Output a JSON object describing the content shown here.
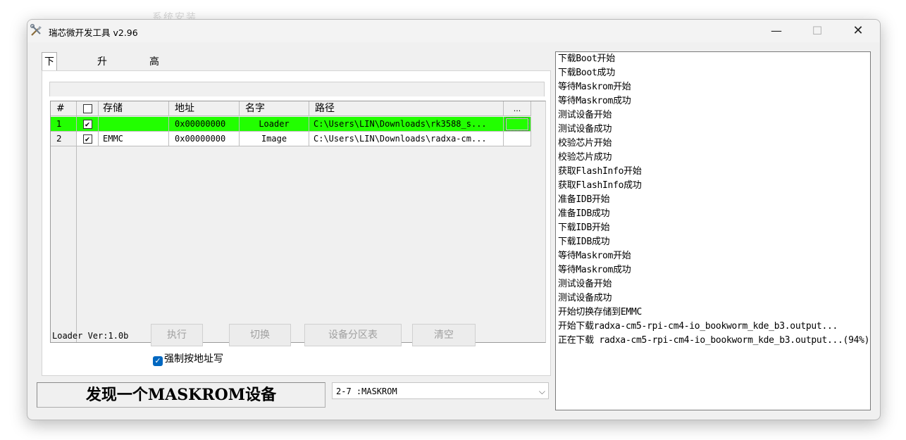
{
  "background_text": "系统安装",
  "window": {
    "title": "瑞芯微开发工具 v2.96",
    "min_symbol": "—",
    "max_symbol": "☐",
    "close_symbol": "✕"
  },
  "tabs": [
    {
      "label": "下载镜像",
      "active": true
    },
    {
      "label": "升级固件",
      "active": false
    },
    {
      "label": "高级功能",
      "active": false
    }
  ],
  "grid": {
    "headers": {
      "num": "#",
      "storage": "存储",
      "address": "地址",
      "name": "名字",
      "path": "路径",
      "more": "..."
    },
    "rows": [
      {
        "num": "1",
        "checked": true,
        "storage": "",
        "address": "0x00000000",
        "name": "Loader",
        "path": "C:\\Users\\LIN\\Downloads\\rk3588_s...",
        "selected": true
      },
      {
        "num": "2",
        "checked": true,
        "storage": "EMMC",
        "address": "0x00000000",
        "name": "Image",
        "path": "C:\\Users\\LIN\\Downloads\\radxa-cm...",
        "selected": false
      }
    ]
  },
  "loader_ver": "Loader Ver:1.0b",
  "buttons": {
    "run": "执行",
    "switch": "切换",
    "partition": "设备分区表",
    "clear": "清空"
  },
  "force_write": {
    "label": "强制按地址写",
    "checked": true
  },
  "status": "发现一个MASKROM设备",
  "device_select": {
    "value": "2-7 :MASKROM"
  },
  "log": [
    "下载Boot开始",
    "下载Boot成功",
    "等待Maskrom开始",
    "等待Maskrom成功",
    "测试设备开始",
    "测试设备成功",
    "校验芯片开始",
    "校验芯片成功",
    "获取FlashInfo开始",
    "获取FlashInfo成功",
    "准备IDB开始",
    "准备IDB成功",
    "下载IDB开始",
    "下载IDB成功",
    "等待Maskrom开始",
    "等待Maskrom成功",
    "测试设备开始",
    "测试设备成功",
    "开始切换存储到EMMC",
    "开始下载radxa-cm5-rpi-cm4-io_bookworm_kde_b3.output...",
    "正在下载 radxa-cm5-rpi-cm4-io_bookworm_kde_b3.output...(94%)"
  ]
}
